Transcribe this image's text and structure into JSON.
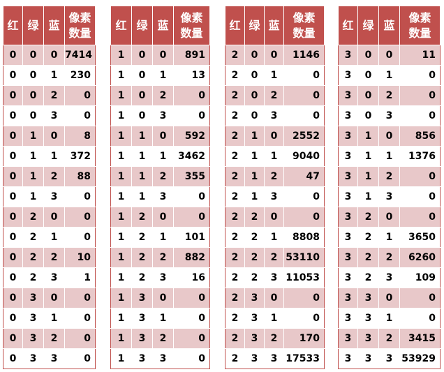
{
  "headers": {
    "r": "红",
    "g": "绿",
    "b": "蓝",
    "count": "像素\n数量"
  },
  "tables": [
    {
      "rows": [
        [
          "0",
          "0",
          "0",
          "7414"
        ],
        [
          "0",
          "0",
          "1",
          "230"
        ],
        [
          "0",
          "0",
          "2",
          "0"
        ],
        [
          "0",
          "0",
          "3",
          "0"
        ],
        [
          "0",
          "1",
          "0",
          "8"
        ],
        [
          "0",
          "1",
          "1",
          "372"
        ],
        [
          "0",
          "1",
          "2",
          "88"
        ],
        [
          "0",
          "1",
          "3",
          "0"
        ],
        [
          "0",
          "2",
          "0",
          "0"
        ],
        [
          "0",
          "2",
          "1",
          "0"
        ],
        [
          "0",
          "2",
          "2",
          "10"
        ],
        [
          "0",
          "2",
          "3",
          "1"
        ],
        [
          "0",
          "3",
          "0",
          "0"
        ],
        [
          "0",
          "3",
          "1",
          "0"
        ],
        [
          "0",
          "3",
          "2",
          "0"
        ],
        [
          "0",
          "3",
          "3",
          "0"
        ]
      ]
    },
    {
      "rows": [
        [
          "1",
          "0",
          "0",
          "891"
        ],
        [
          "1",
          "0",
          "1",
          "13"
        ],
        [
          "1",
          "0",
          "2",
          "0"
        ],
        [
          "1",
          "0",
          "3",
          "0"
        ],
        [
          "1",
          "1",
          "0",
          "592"
        ],
        [
          "1",
          "1",
          "1",
          "3462"
        ],
        [
          "1",
          "1",
          "2",
          "355"
        ],
        [
          "1",
          "1",
          "3",
          "0"
        ],
        [
          "1",
          "2",
          "0",
          "0"
        ],
        [
          "1",
          "2",
          "1",
          "101"
        ],
        [
          "1",
          "2",
          "2",
          "882"
        ],
        [
          "1",
          "2",
          "3",
          "16"
        ],
        [
          "1",
          "3",
          "0",
          "0"
        ],
        [
          "1",
          "3",
          "1",
          "0"
        ],
        [
          "1",
          "3",
          "2",
          "0"
        ],
        [
          "1",
          "3",
          "3",
          "0"
        ]
      ]
    },
    {
      "rows": [
        [
          "2",
          "0",
          "0",
          "1146"
        ],
        [
          "2",
          "0",
          "1",
          "0"
        ],
        [
          "2",
          "0",
          "2",
          "0"
        ],
        [
          "2",
          "0",
          "3",
          "0"
        ],
        [
          "2",
          "1",
          "0",
          "2552"
        ],
        [
          "2",
          "1",
          "1",
          "9040"
        ],
        [
          "2",
          "1",
          "2",
          "47"
        ],
        [
          "2",
          "1",
          "3",
          "0"
        ],
        [
          "2",
          "2",
          "0",
          "0"
        ],
        [
          "2",
          "2",
          "1",
          "8808"
        ],
        [
          "2",
          "2",
          "2",
          "53110"
        ],
        [
          "2",
          "2",
          "3",
          "11053"
        ],
        [
          "2",
          "3",
          "0",
          "0"
        ],
        [
          "2",
          "3",
          "1",
          "0"
        ],
        [
          "2",
          "3",
          "2",
          "170"
        ],
        [
          "2",
          "3",
          "3",
          "17533"
        ]
      ]
    },
    {
      "rows": [
        [
          "3",
          "0",
          "0",
          "11"
        ],
        [
          "3",
          "0",
          "1",
          "0"
        ],
        [
          "3",
          "0",
          "2",
          "0"
        ],
        [
          "3",
          "0",
          "3",
          "0"
        ],
        [
          "3",
          "1",
          "0",
          "856"
        ],
        [
          "3",
          "1",
          "1",
          "1376"
        ],
        [
          "3",
          "1",
          "2",
          "0"
        ],
        [
          "3",
          "1",
          "3",
          "0"
        ],
        [
          "3",
          "2",
          "0",
          "0"
        ],
        [
          "3",
          "2",
          "1",
          "3650"
        ],
        [
          "3",
          "2",
          "2",
          "6260"
        ],
        [
          "3",
          "2",
          "3",
          "109"
        ],
        [
          "3",
          "3",
          "0",
          "0"
        ],
        [
          "3",
          "3",
          "1",
          "0"
        ],
        [
          "3",
          "3",
          "2",
          "3415"
        ],
        [
          "3",
          "3",
          "3",
          "53929"
        ]
      ]
    }
  ]
}
